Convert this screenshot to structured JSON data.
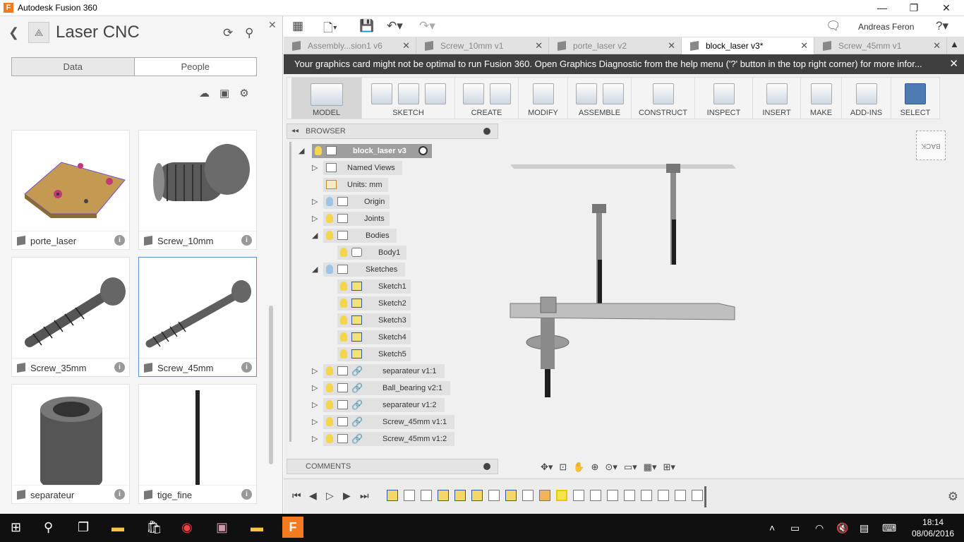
{
  "window": {
    "title": "Autodesk Fusion 360",
    "logo": "F"
  },
  "left_panel": {
    "project_title": "Laser CNC",
    "tabs": [
      "Data",
      "People"
    ],
    "items": [
      {
        "name": "porte_laser"
      },
      {
        "name": "Screw_10mm"
      },
      {
        "name": "Screw_35mm"
      },
      {
        "name": "Screw_45mm"
      },
      {
        "name": "separateur"
      },
      {
        "name": "tige_fine"
      }
    ]
  },
  "toolbar": {
    "user": "Andreas Feron"
  },
  "doc_tabs": [
    "Assembly...sion1 v6",
    "Screw_10mm v1",
    "porte_laser v2",
    "block_laser v3*",
    "Screw_45mm v1"
  ],
  "warning": "Your graphics card might not be optimal to run Fusion 360. Open Graphics Diagnostic from the help menu ('?' button in the top right corner) for more infor...",
  "ribbon": [
    "MODEL",
    "SKETCH",
    "CREATE",
    "MODIFY",
    "ASSEMBLE",
    "CONSTRUCT",
    "INSPECT",
    "INSERT",
    "MAKE",
    "ADD-INS",
    "SELECT"
  ],
  "browser": {
    "title": "BROWSER",
    "root": "block_laser v3",
    "named_views": "Named Views",
    "units": "Units: mm",
    "origin": "Origin",
    "joints": "Joints",
    "bodies": "Bodies",
    "body1": "Body1",
    "sketches_folder": "Sketches",
    "sketches": [
      "Sketch1",
      "Sketch2",
      "Sketch3",
      "Sketch4",
      "Sketch5"
    ],
    "components": [
      "separateur v1:1",
      "Ball_bearing v2:1",
      "separateur v1:2",
      "Screw_45mm v1:1",
      "Screw_45mm v1:2"
    ]
  },
  "comments_label": "COMMENTS",
  "viewcube_label": "BACK",
  "clock": {
    "time": "18:14",
    "date": "08/06/2016"
  },
  "colors": {
    "accent": "#5b8ed6",
    "warning_bg": "#3f3f3f",
    "taskbar": "#101010"
  }
}
